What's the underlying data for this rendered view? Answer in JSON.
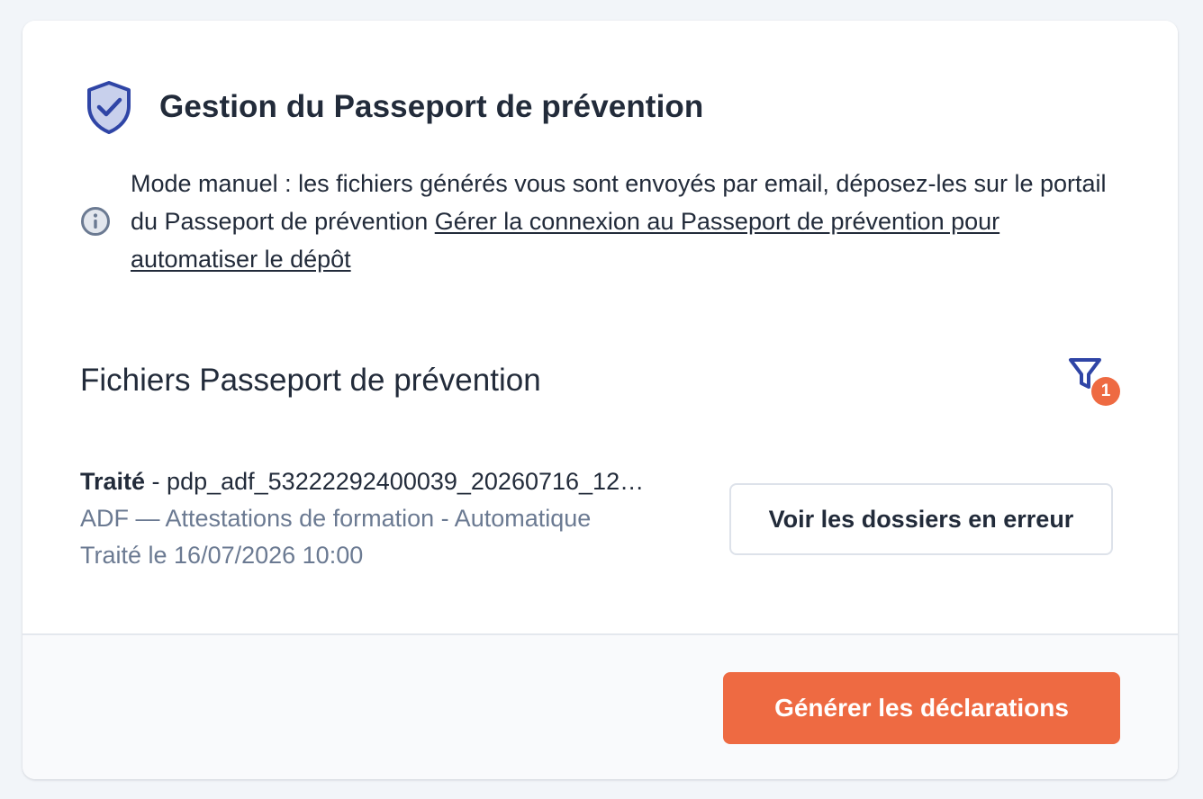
{
  "header": {
    "title": "Gestion du Passeport de prévention",
    "icon": "shield-check-icon"
  },
  "info": {
    "icon": "info-icon",
    "text": "Mode manuel : les fichiers générés vous sont envoyés par email, déposez-les sur le portail du Passeport de prévention ",
    "link_text": " Gérer la connexion au Passeport de prévention pour automatiser le dépôt"
  },
  "files_section": {
    "title": "Fichiers Passeport de prévention",
    "filter_icon": "filter-icon",
    "filter_count": "1",
    "file": {
      "status": "Traité",
      "separator": " - ",
      "filename": "pdp_adf_53222292400039_20260716_12…",
      "type": "ADF — Attestations de formation - Automatique",
      "processed_at": "Traité le 16/07/2026 10:00"
    },
    "errors_button_label": "Voir les dossiers en erreur"
  },
  "footer": {
    "generate_button_label": "Générer les déclarations"
  },
  "colors": {
    "accent": "#ee6a42",
    "brand_blue": "#2f45a6",
    "text": "#222b3a",
    "muted": "#6b7a92"
  }
}
